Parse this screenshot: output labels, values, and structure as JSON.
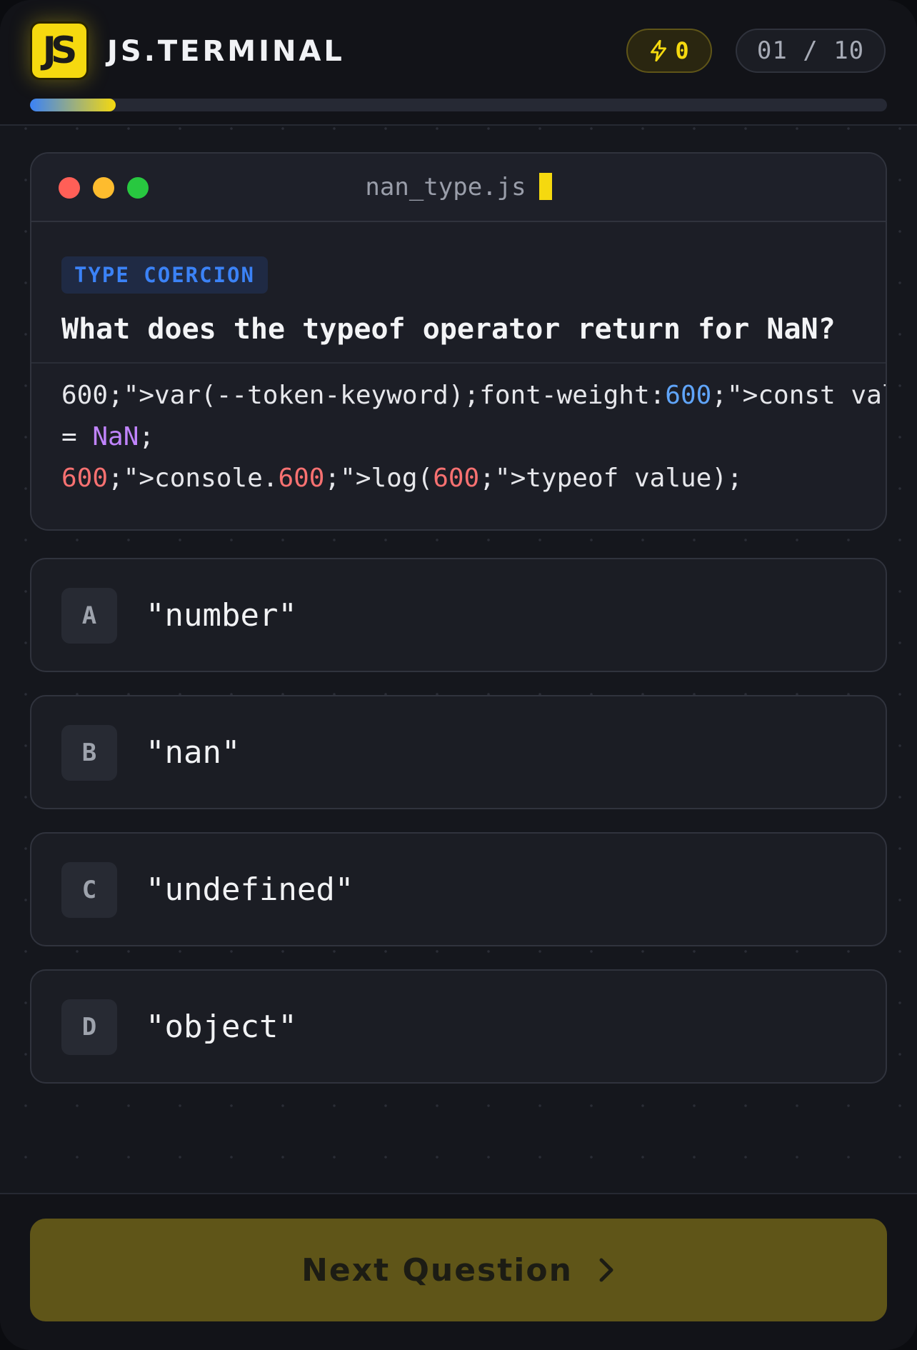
{
  "header": {
    "logo_text": "JS",
    "brand": "JS.TERMINAL",
    "score": "0",
    "counter": "01 / 10",
    "progress_fraction": 0.1
  },
  "card": {
    "filename": "nan_type.js",
    "tag": "TYPE COERCION",
    "question": "What does the typeof operator return for NaN?",
    "code": {
      "line1_a": "600",
      "line1_b": ";\">var(--token-keyword);font-weight:",
      "line1_c": "600",
      "line1_d": ";\">const value",
      "line2_a": "= ",
      "line2_b": "NaN",
      "line2_c": ";",
      "line3_a": "600",
      "line3_b": ";\">console.",
      "line3_c": "600",
      "line3_d": ";\">log(",
      "line3_e": "600",
      "line3_f": ";\">typeof value);"
    }
  },
  "options": [
    {
      "key": "A",
      "text": "\"number\""
    },
    {
      "key": "B",
      "text": "\"nan\""
    },
    {
      "key": "C",
      "text": "\"undefined\""
    },
    {
      "key": "D",
      "text": "\"object\""
    }
  ],
  "footer": {
    "next_label": "Next Question"
  },
  "icons": {
    "score": "lightning-icon",
    "next": "chevron-right-icon"
  },
  "colors": {
    "accent": "#f5d90f",
    "blue": "#3b82f6",
    "background": "#15171d"
  }
}
